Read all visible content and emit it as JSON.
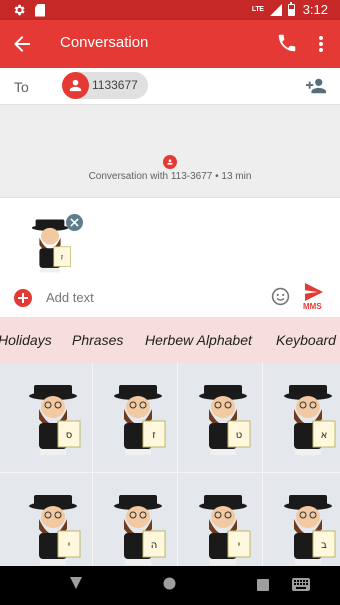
{
  "status_bar": {
    "time": "3:12",
    "network": "LTE",
    "icons": [
      "settings-icon",
      "sd-card-icon",
      "signal-icon",
      "battery-icon"
    ]
  },
  "app_bar": {
    "title": "Conversation",
    "icons": [
      "back-arrow-icon",
      "call-icon",
      "more-vert-icon"
    ]
  },
  "recipients": {
    "to_label": "To",
    "chip_text": "1133677"
  },
  "conversation": {
    "info_text": "Conversation with 113-3677 • 13 min"
  },
  "compose": {
    "placeholder": "Add text",
    "send_label": "MMS",
    "attachment": "rabbi-sticker"
  },
  "sticker_tabs": [
    {
      "label": "Holidays"
    },
    {
      "label": "Phrases"
    },
    {
      "label": "Herbew Alphabet"
    },
    {
      "label": "Keyboard"
    }
  ],
  "stickers": [
    {
      "letter": "ס"
    },
    {
      "letter": "ז"
    },
    {
      "letter": "ט"
    },
    {
      "letter": "א"
    },
    {
      "letter": "י"
    },
    {
      "letter": "ה"
    },
    {
      "letter": "י"
    },
    {
      "letter": "ב"
    }
  ],
  "nav_bar": {
    "icons": [
      "back-triangle-icon",
      "home-circle-icon",
      "recents-square-icon",
      "keyboard-icon"
    ]
  },
  "colors": {
    "status_bar": "#c62828",
    "app_bar": "#e53935",
    "accent": "#e53935",
    "tab_strip": "#f5dedd",
    "sticker_bg": "#e4e7eb"
  }
}
